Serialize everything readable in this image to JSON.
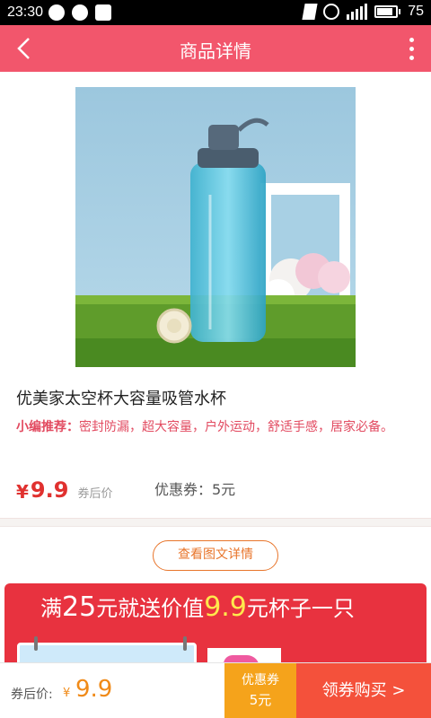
{
  "status_bar": {
    "time": "23:30",
    "battery_level": "75"
  },
  "header": {
    "title": "商品详情"
  },
  "product": {
    "title": "优美家太空杯大容量吸管水杯",
    "recommend_label": "小编推荐：",
    "recommend_text": "密封防漏，超大容量，户外运动，舒适手感，居家必备。",
    "currency": "¥",
    "price": "9.9",
    "price_note": "券后价",
    "coupon_text": "优惠券：5元"
  },
  "detail_button": "查看图文详情",
  "promo": {
    "text_a": "满",
    "amount": "25",
    "text_b": "元就送价值",
    "gift_value": "9.9",
    "text_c": "元杯子一只"
  },
  "bottom_bar": {
    "after_label": "券后价:",
    "currency": "¥",
    "price": "9.9",
    "coupon_line1": "优惠券",
    "coupon_line2": "5元",
    "buy_label": "领券购买 >"
  },
  "colors": {
    "header": "#f2566c",
    "accent_red": "#e0312f",
    "orange": "#f08a18",
    "coupon_bg": "#f5a31b",
    "buy_bg": "#f4513b"
  }
}
